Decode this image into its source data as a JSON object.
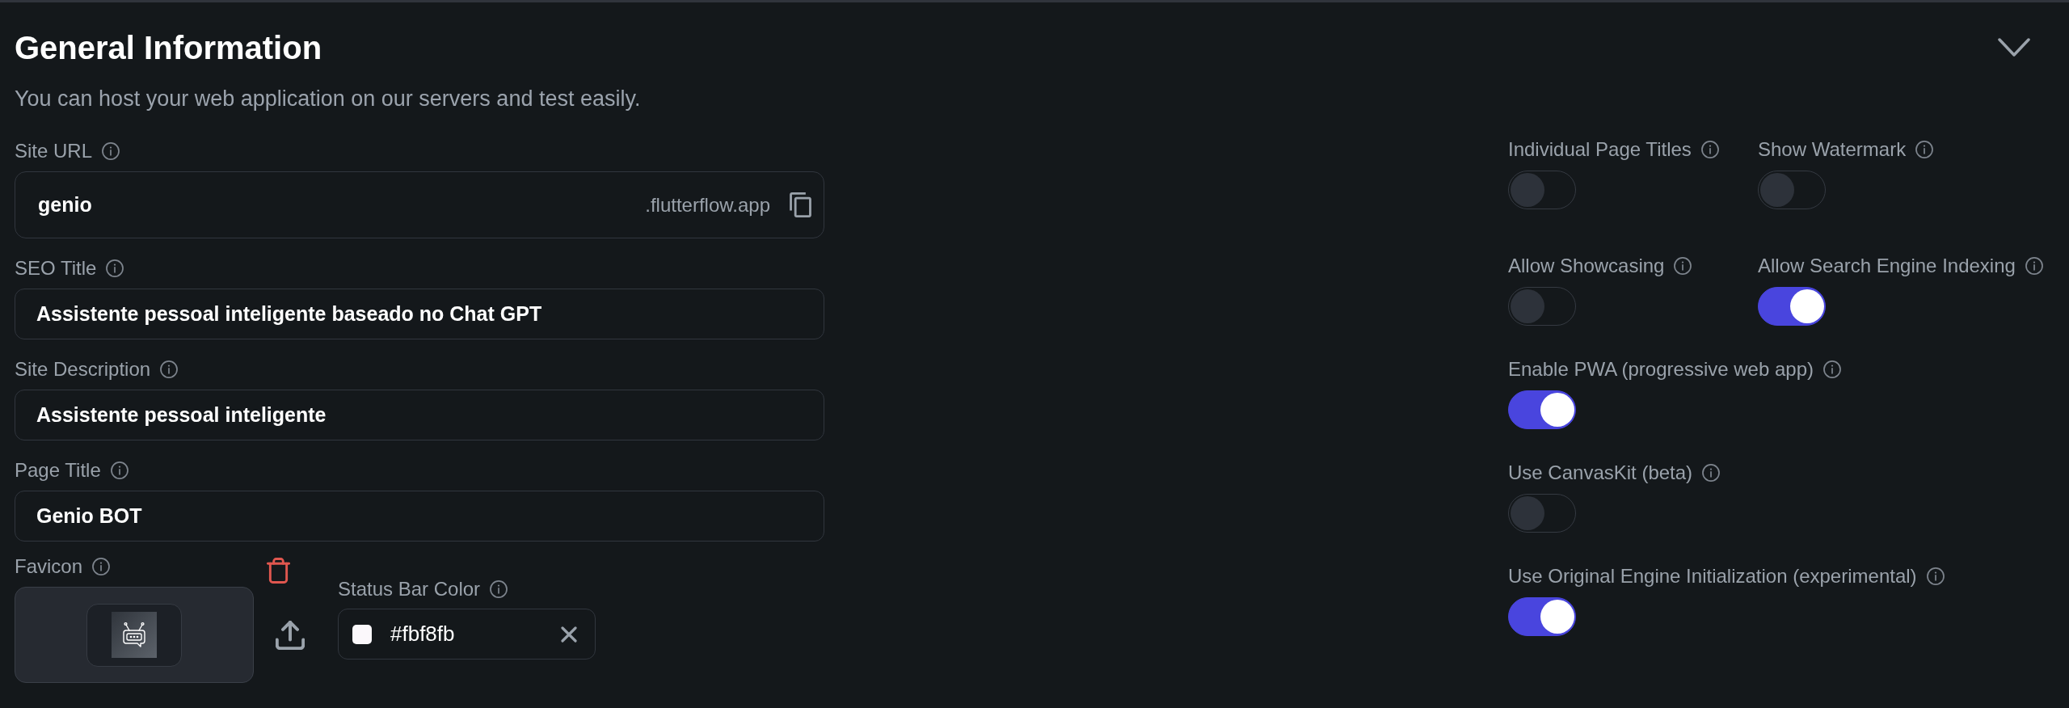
{
  "section": {
    "title": "General Information",
    "subtitle": "You can host your web application on our servers and test easily."
  },
  "site_url": {
    "label": "Site URL",
    "value": "genio",
    "suffix": ".flutterflow.app"
  },
  "fields": [
    {
      "label": "SEO Title",
      "value": "Assistente pessoal inteligente baseado no Chat GPT"
    },
    {
      "label": "Site Description",
      "value": "Assistente pessoal inteligente"
    },
    {
      "label": "Page Title",
      "value": "Genio BOT"
    }
  ],
  "favicon": {
    "label": "Favicon"
  },
  "status_bar_color": {
    "label": "Status Bar Color",
    "value": "#fbf8fb",
    "color": "#fbf8fb"
  },
  "toggle_rows": [
    [
      {
        "label": "Individual Page Titles",
        "on": false
      },
      {
        "label": "Show Watermark",
        "on": false
      }
    ],
    [
      {
        "label": "Allow Showcasing",
        "on": false
      },
      {
        "label": "Allow Search Engine Indexing",
        "on": true
      }
    ],
    [
      {
        "label": "Enable PWA (progressive web app)",
        "on": true
      }
    ],
    [
      {
        "label": "Use CanvasKit (beta)",
        "on": false
      }
    ],
    [
      {
        "label": "Use Original Engine Initialization (experimental)",
        "on": true
      }
    ]
  ]
}
